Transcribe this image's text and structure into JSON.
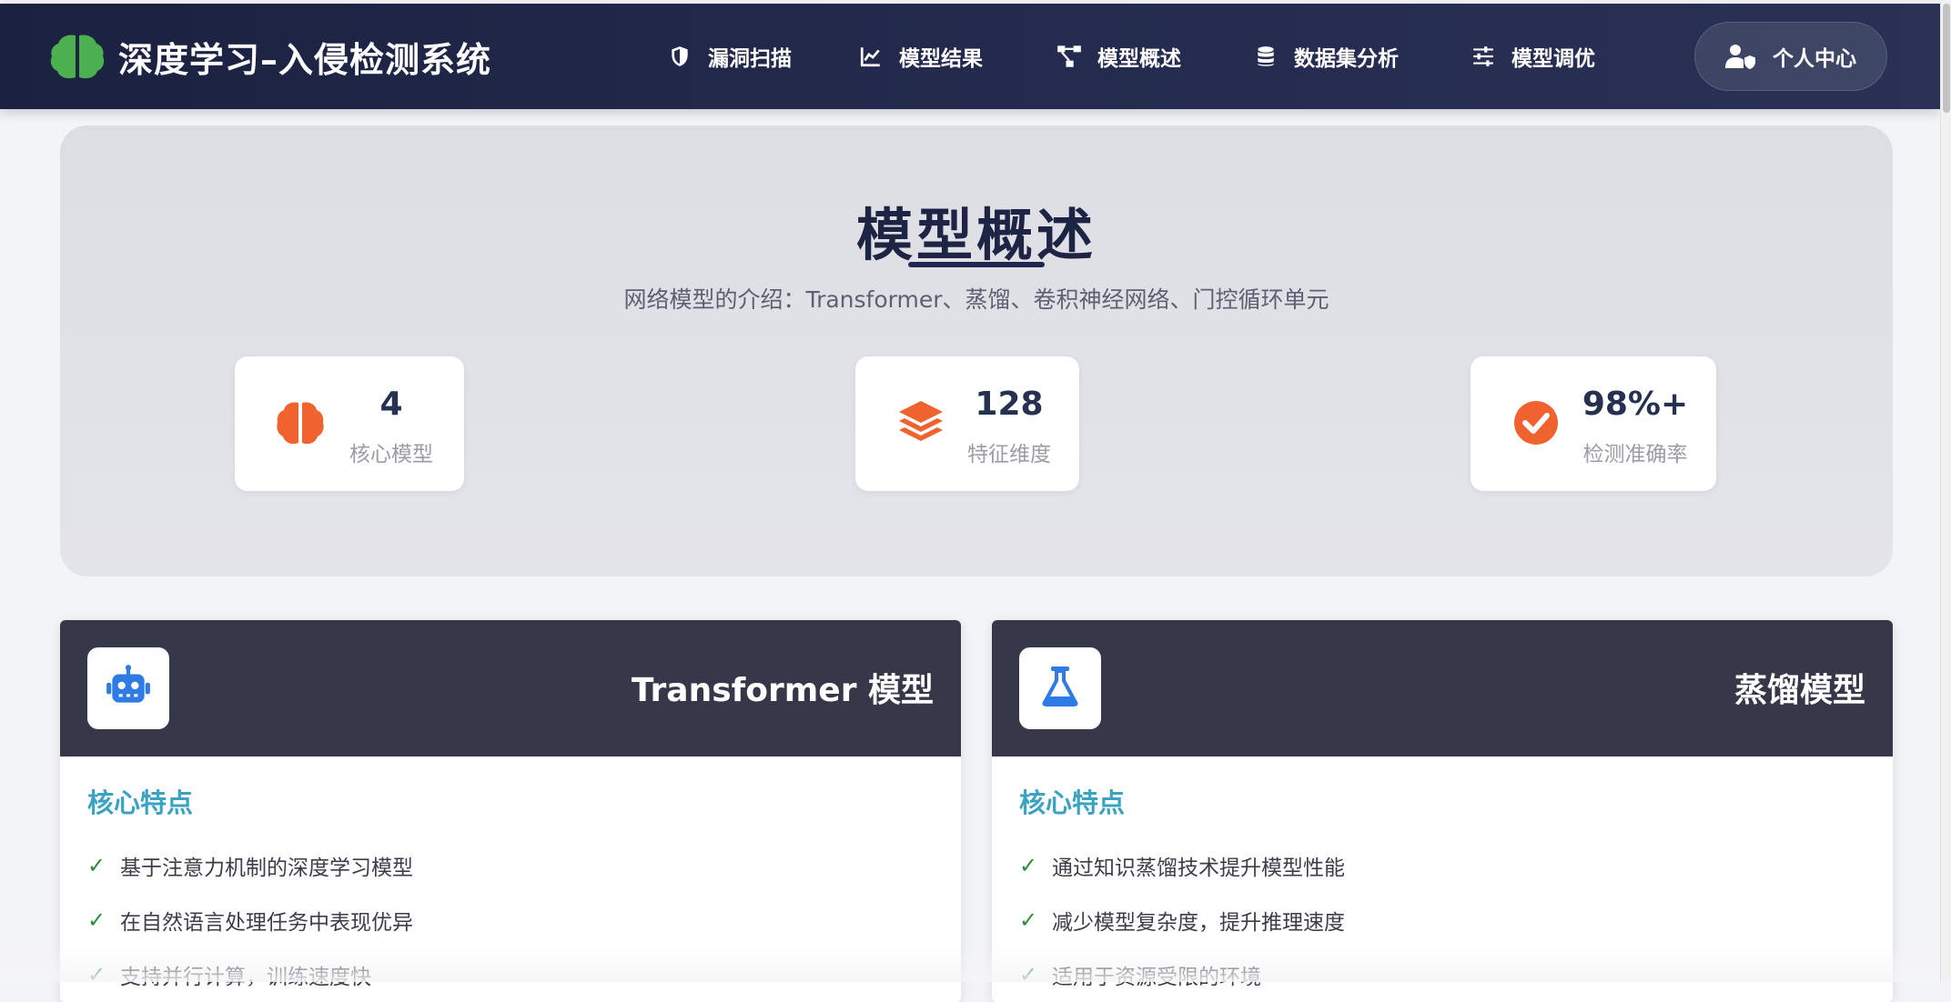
{
  "brand": {
    "title": "深度学习–入侵检测系统",
    "icon": "brain-icon",
    "icon_color": "#4caf50"
  },
  "nav": {
    "items": [
      {
        "label": "漏洞扫描",
        "icon": "shield-icon"
      },
      {
        "label": "模型结果",
        "icon": "line-chart-icon"
      },
      {
        "label": "模型概述",
        "icon": "network-icon"
      },
      {
        "label": "数据集分析",
        "icon": "database-icon"
      },
      {
        "label": "模型调优",
        "icon": "sliders-icon"
      }
    ],
    "user": {
      "label": "个人中心",
      "icon": "user-shield-icon"
    }
  },
  "hero": {
    "title": "模型概述",
    "subtitle": "网络模型的介绍：Transformer、蒸馏、卷积神经网络、门控循环单元",
    "stats": [
      {
        "value": "4",
        "label": "核心模型",
        "icon": "brain-icon"
      },
      {
        "value": "128",
        "label": "特征维度",
        "icon": "layers-icon"
      },
      {
        "value": "98%+",
        "label": "检测准确率",
        "icon": "check-circle-icon"
      }
    ],
    "accent_color": "#f0622e"
  },
  "models": [
    {
      "title": "Transformer 模型",
      "icon": "robot-icon",
      "section": "核心特点",
      "features": [
        "基于注意力机制的深度学习模型",
        "在自然语言处理任务中表现优异",
        "支持并行计算，训练速度快"
      ]
    },
    {
      "title": "蒸馏模型",
      "icon": "flask-icon",
      "section": "核心特点",
      "features": [
        "通过知识蒸馏技术提升模型性能",
        "减少模型复杂度，提升推理速度",
        "适用于资源受限的环境"
      ]
    }
  ],
  "check_mark": "✓",
  "colors": {
    "nav_bg": "#1b2140",
    "card_header": "#363849",
    "section_title": "#3aa3c2",
    "check": "#2e8b3d",
    "icon_blue": "#2f7be5"
  }
}
